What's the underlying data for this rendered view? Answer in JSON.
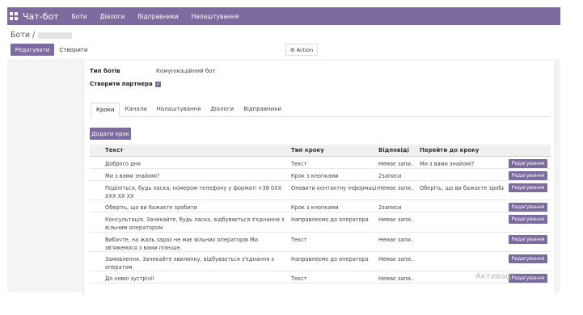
{
  "navbar": {
    "brand": "Чат-бот",
    "menu": [
      "Боти",
      "Діалоги",
      "Відправники",
      "Налаштування"
    ]
  },
  "controlpanel": {
    "breadcrumb": "Боти /",
    "edit_label": "Редагувати",
    "create_label": "Створити",
    "action_label": "Action"
  },
  "form": {
    "bot_type_label": "Тип ботів",
    "bot_type_value": "Комунікаційний бот",
    "create_partner_label": "Створити партнера",
    "create_partner_checked": true
  },
  "tabs": [
    "Кроки",
    "Канали",
    "Налаштування",
    "Діалоги",
    "Відправники"
  ],
  "active_tab": "Кроки",
  "add_step_label": "Додати крок",
  "grid": {
    "headers": {
      "text": "Текст",
      "type": "Тип кроку",
      "answers": "Відповіді",
      "next": "Перейти до кроку"
    },
    "rows": [
      {
        "text": "Доброго дня",
        "type": "Текст",
        "answers": "Немає запи...",
        "next": "Ми з вами знайомі?",
        "btn": "Редагування"
      },
      {
        "text": "Ми з вами знайомі?",
        "type": "Крок з кнопками",
        "answers": "2записи",
        "next": "",
        "btn": "Редагування"
      },
      {
        "text": "Поділіться, будь ласка, номером телефону у форматі +38 0XX XXX XX XX",
        "type": "Оновити контактну інформацію",
        "answers": "Немає запи...",
        "next": "Оберіть, що ви бажаєте зроби...",
        "btn": "Редагування"
      },
      {
        "text": "Оберіть, що ви бажаєте зробити",
        "type": "Крок з кнопками",
        "answers": "2записи",
        "next": "",
        "btn": "Редагування"
      },
      {
        "text": "Консультація. Зачекайте, будь ласка, відбувається з'єднання з вільним оператором",
        "type": "Направлеємо до оператора",
        "answers": "Немає запи...",
        "next": "",
        "btn": "Редагування"
      },
      {
        "text": "Вибачте, на жаль зараз не має вільних операторів   Ми зв'яжемося з вами пізніше.",
        "type": "Текст",
        "answers": "Немає запи...",
        "next": "",
        "btn": "Редагування"
      },
      {
        "text": "Замовлення. Зачекайте хвилинку, відбувається з'єднання з оператом",
        "type": "Направлеємо до оператора",
        "answers": "Немає запи...",
        "next": "",
        "btn": "Редагування"
      },
      {
        "text": "До нової зустрічі!",
        "type": "Текст",
        "answers": "Немає запи...",
        "next": "",
        "btn": "Редагування"
      }
    ]
  },
  "watermark": "Активаці",
  "colors": {
    "accent": "#7c6b9e",
    "navbar": "#7c6b9e",
    "background": "#f4f4f4"
  }
}
